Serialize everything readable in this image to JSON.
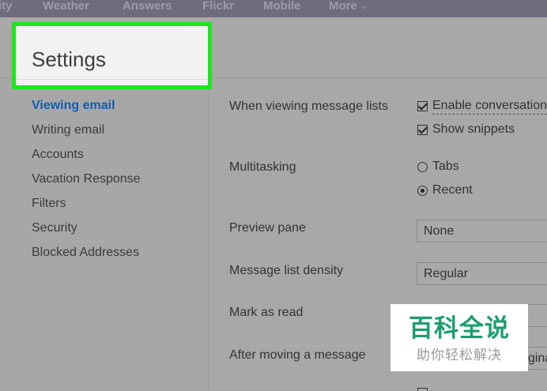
{
  "topnav": {
    "items": [
      "ity",
      "Weather",
      "Answers",
      "Flickr",
      "Mobile",
      "More"
    ],
    "more_chevron": "chevron-down-icon"
  },
  "settings": {
    "title": "Settings"
  },
  "sidebar": {
    "items": [
      {
        "label": "Viewing email",
        "active": true
      },
      {
        "label": "Writing email",
        "active": false
      },
      {
        "label": "Accounts",
        "active": false
      },
      {
        "label": "Vacation Response",
        "active": false
      },
      {
        "label": "Filters",
        "active": false
      },
      {
        "label": "Security",
        "active": false
      },
      {
        "label": "Blocked Addresses",
        "active": false
      }
    ]
  },
  "main": {
    "message_lists": {
      "label": "When viewing message lists",
      "enable_conversations": {
        "label": "Enable conversation",
        "checked": true
      },
      "show_snippets": {
        "label": "Show snippets",
        "checked": true
      }
    },
    "multitasking": {
      "label": "Multitasking",
      "tabs": {
        "label": "Tabs",
        "selected": false
      },
      "recent": {
        "label": "Recent",
        "selected": true
      }
    },
    "preview_pane": {
      "label": "Preview pane",
      "value": "None"
    },
    "density": {
      "label": "Message list density",
      "value": "Regular"
    },
    "mark_as_read": {
      "label": "Mark as read"
    },
    "after_moving": {
      "label": "After moving a message",
      "value_fragment": "gina"
    }
  },
  "watermark": {
    "main": "百科全说",
    "sub": "助你轻松解决"
  },
  "colors": {
    "highlight_border": "#1ee61e",
    "active_link": "#0f5db4",
    "watermark_green": "#1b9e6e"
  }
}
